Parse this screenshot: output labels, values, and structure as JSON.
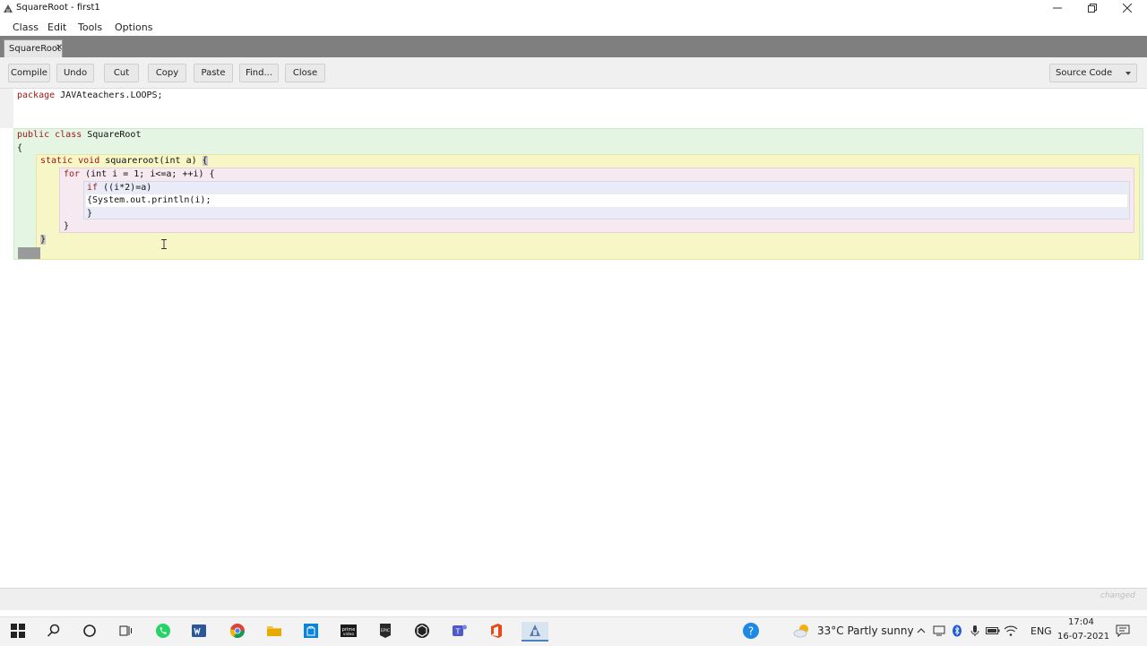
{
  "window": {
    "title": "SquareRoot - first1"
  },
  "menu": [
    "Class",
    "Edit",
    "Tools",
    "Options"
  ],
  "tabs": [
    {
      "label": "SquareRoot",
      "close": "✕"
    }
  ],
  "toolbar": {
    "buttons": [
      "Compile",
      "Undo",
      "Cut",
      "Copy",
      "Paste",
      "Find...",
      "Close"
    ],
    "view_select": "Source Code"
  },
  "code": {
    "l1_kw": "package",
    "l1_rest": " JAVAteachers.LOOPS;",
    "l2_kw": "public class",
    "l2_rest": " SquareRoot",
    "l3": "{",
    "l4_kw": "static void",
    "l4_rest": " squareroot(int a) ",
    "l4_brace": "{",
    "l5_kw": "for",
    "l5_rest": " (int i = 1; i<=a; ++i) {",
    "l6_kw": "if",
    "l6_rest": " ((i*2)=a)",
    "l7": "{System.out.println(i);",
    "l8": "}",
    "l9": "}",
    "l10": "}"
  },
  "status": {
    "changed": "changed"
  },
  "system_tray": {
    "weather": "33°C  Partly sunny",
    "language": "ENG",
    "time": "17:04",
    "date": "16-07-2021"
  },
  "colors": {
    "class_scope": "#e4f5e4",
    "method_scope": "#f7f6c6",
    "loop_scope": "#f7e9f0",
    "if_scope": "#e9ecf6",
    "keyword": "#a01818",
    "tab_strip": "#7f7f7f"
  },
  "icons": [
    "app-icon",
    "minimize-icon",
    "restore-icon",
    "close-icon",
    "windows-start-icon",
    "search-icon",
    "cortana-icon",
    "task-view-icon",
    "whatsapp-icon",
    "word-icon",
    "chrome-icon",
    "file-explorer-icon",
    "store-icon",
    "prime-video-icon",
    "epic-games-icon",
    "unity-icon",
    "teams-icon",
    "office-icon",
    "bluej-icon",
    "help-icon",
    "weather-icon",
    "notification-icon"
  ]
}
